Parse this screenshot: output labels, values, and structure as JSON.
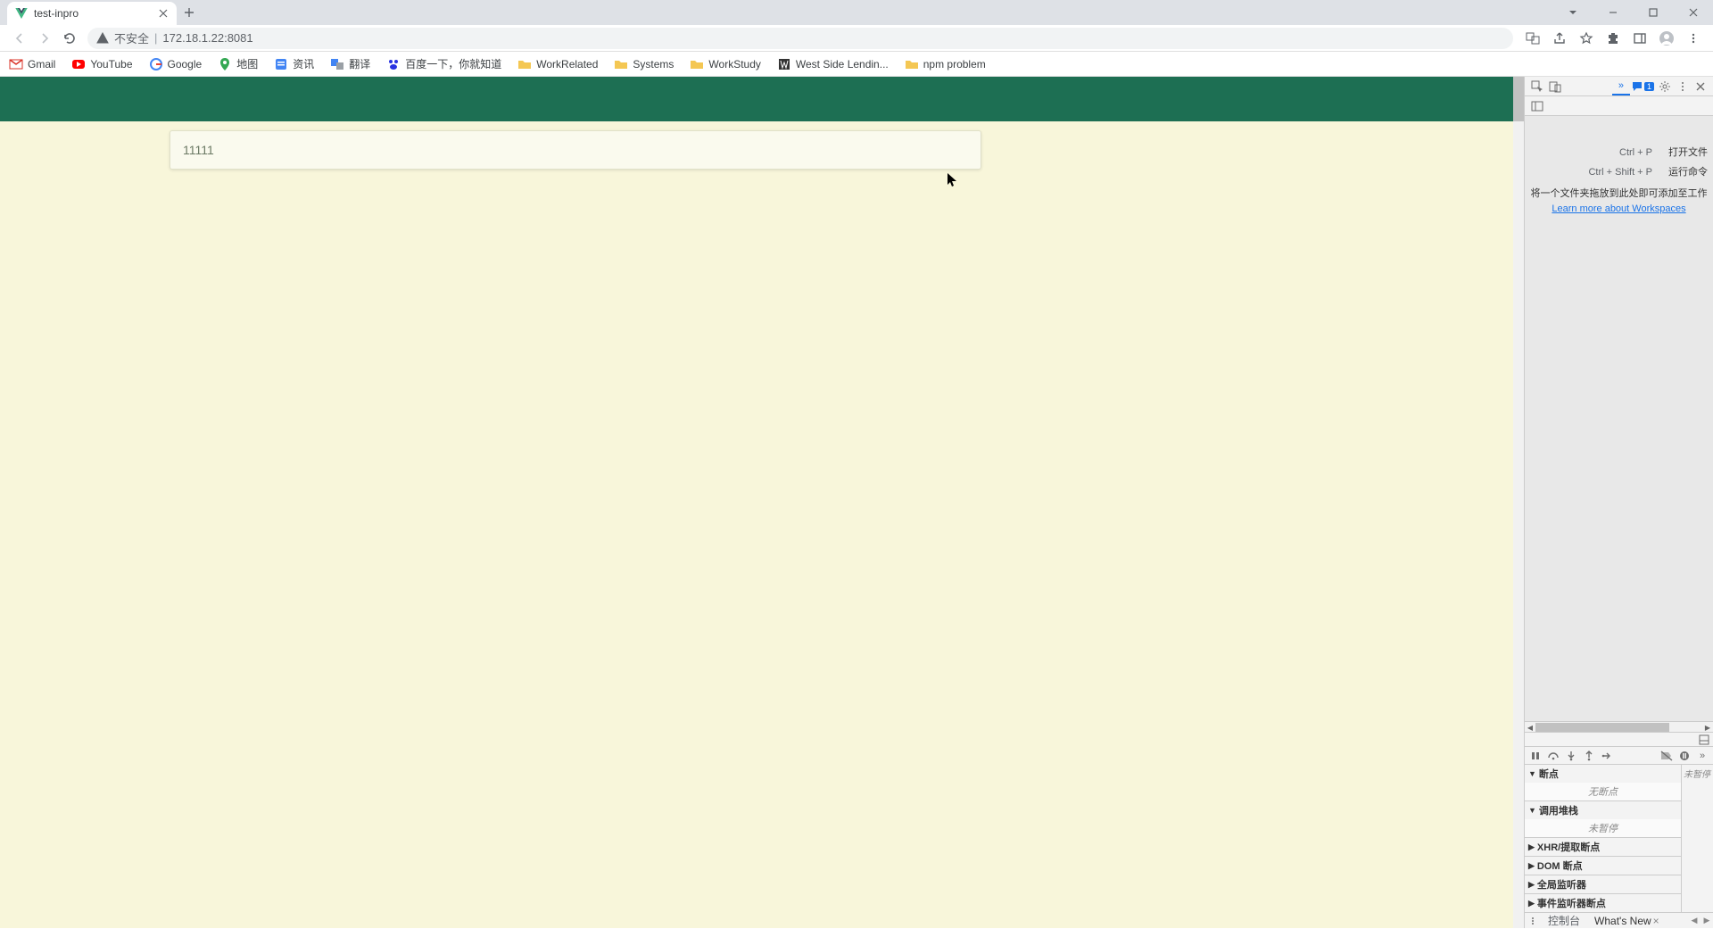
{
  "browser": {
    "tab_title": "test-inpro",
    "security_label": "不安全",
    "url": "172.18.1.22:8081",
    "window_buttons": {
      "dropdown": "⌄",
      "minimize": "—",
      "maximize": "▢",
      "close": "✕"
    }
  },
  "bookmarks": [
    {
      "label": "Gmail"
    },
    {
      "label": "YouTube"
    },
    {
      "label": "Google"
    },
    {
      "label": "地图"
    },
    {
      "label": "资讯"
    },
    {
      "label": "翻译"
    },
    {
      "label": "百度一下，你就知道"
    },
    {
      "label": "WorkRelated"
    },
    {
      "label": "Systems"
    },
    {
      "label": "WorkStudy"
    },
    {
      "label": "West Side Lendin..."
    },
    {
      "label": "npm problem"
    }
  ],
  "page": {
    "box_text": "11111"
  },
  "devtools": {
    "messages_badge": "1",
    "hints": [
      {
        "kbd": "Ctrl + P",
        "label": "打开文件"
      },
      {
        "kbd": "Ctrl + Shift + P",
        "label": "运行命令"
      }
    ],
    "drop_hint": "将一个文件夹拖放到此处即可添加至工作",
    "learn_link": "Learn more about Workspaces",
    "status_text": "未暂停",
    "sections": {
      "breakpoints": {
        "title": "断点",
        "body": "无断点"
      },
      "callstack": {
        "title": "调用堆栈",
        "body": "未暂停"
      },
      "xhr": "XHR/提取断点",
      "dom": "DOM 断点",
      "global": "全局监听器",
      "event": "事件监听器断点"
    },
    "drawer": {
      "console": "控制台",
      "whatsnew": "What's New"
    }
  }
}
